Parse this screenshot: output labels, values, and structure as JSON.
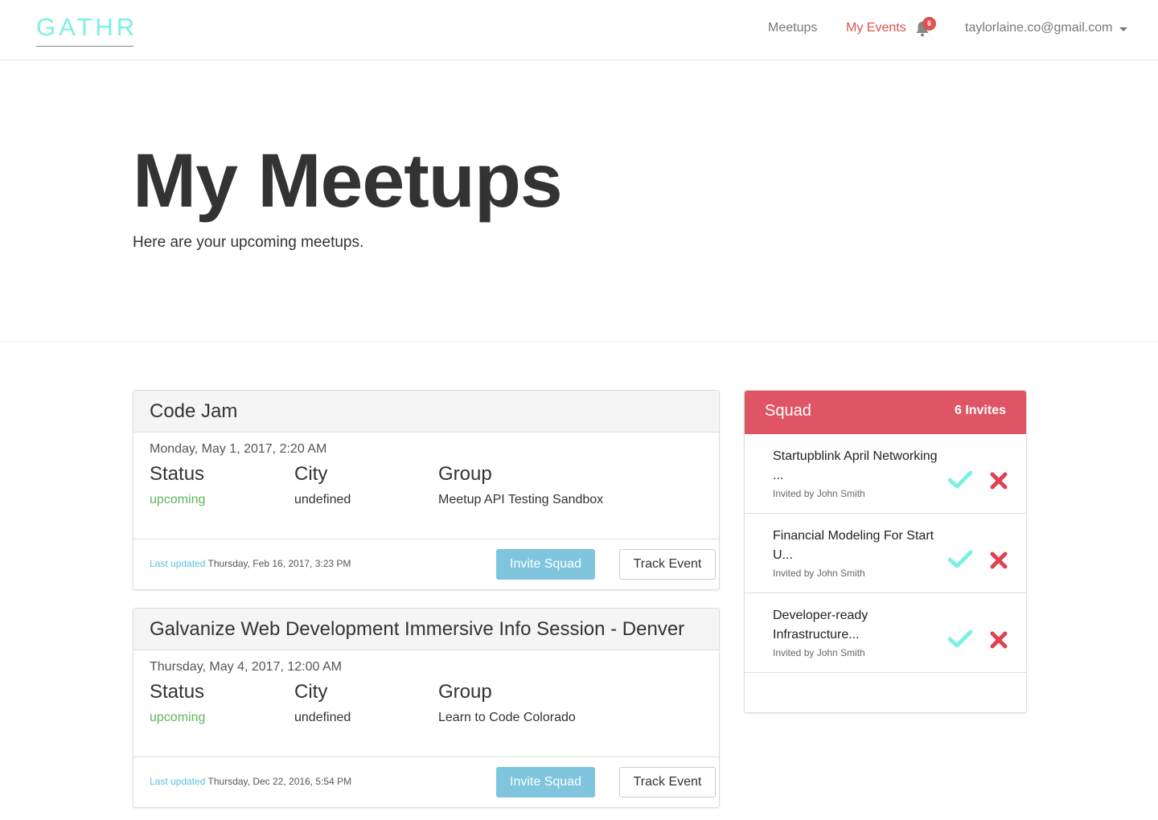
{
  "nav": {
    "brand": "GATHR",
    "meetups": "Meetups",
    "my_events": "My Events",
    "notification_count": "6",
    "user_email": "taylorlaine.co@gmail.com"
  },
  "jumbotron": {
    "title": "My Meetups",
    "subtitle": "Here are your upcoming meetups."
  },
  "labels": {
    "status": "Status",
    "city": "City",
    "group": "Group",
    "last_updated": "Last updated",
    "invite_squad": "Invite Squad",
    "track_event": "Track Event"
  },
  "events": [
    {
      "title": "Code Jam",
      "date": "Monday, May 1, 2017, 2:20 AM",
      "status": "upcoming",
      "city": "undefined",
      "group": "Meetup API Testing Sandbox",
      "updated": "Thursday, Feb 16, 2017, 3:23 PM"
    },
    {
      "title": "Galvanize Web Development Immersive Info Session - Denver",
      "date": "Thursday, May 4, 2017, 12:00 AM",
      "status": "upcoming",
      "city": "undefined",
      "group": "Learn to Code Colorado",
      "updated": "Thursday, Dec 22, 2016, 5:54 PM"
    }
  ],
  "squad": {
    "title": "Squad",
    "count": "6 Invites",
    "invites": [
      {
        "name": "Startupblink April Networking ...",
        "by": "Invited by John Smith"
      },
      {
        "name": "Financial Modeling For Start U...",
        "by": "Invited by John Smith"
      },
      {
        "name": "Developer-ready Infrastructure...",
        "by": "Invited by John Smith"
      }
    ]
  },
  "colors": {
    "brand": "#7ef0e0",
    "active_nav": "#d9534f",
    "squad_header": "#e05565",
    "upcoming": "#5cb85c",
    "invite_button": "#7fc5de",
    "accept": "#7ef0e0",
    "decline": "#e0404f"
  }
}
